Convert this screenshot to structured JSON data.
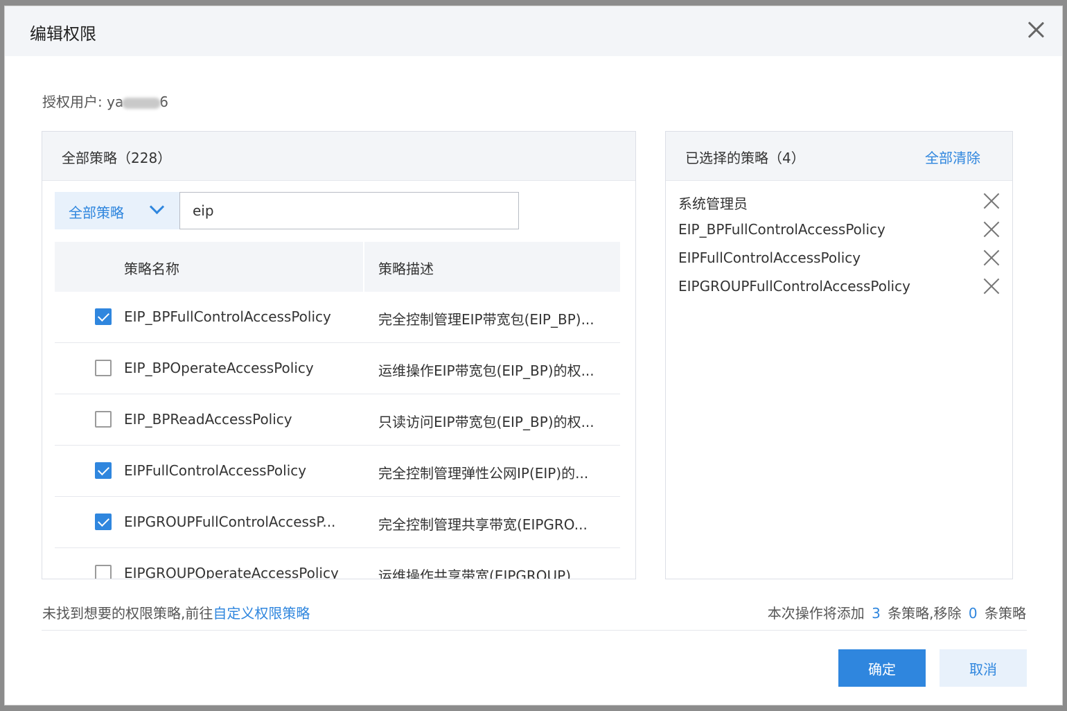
{
  "modal": {
    "title": "编辑权限",
    "auth_user_label": "授权用户: ",
    "auth_user_prefix": "ya",
    "auth_user_suffix": "6"
  },
  "left_panel": {
    "title": "全部策略（228）",
    "filter_selected": "全部策略",
    "search_value": "eip",
    "columns": {
      "name": "策略名称",
      "desc": "策略描述"
    },
    "rows": [
      {
        "name": "EIP_BPFullControlAccessPolicy",
        "desc": "完全控制管理EIP带宽包(EIP_BP)...",
        "checked": true
      },
      {
        "name": "EIP_BPOperateAccessPolicy",
        "desc": "运维操作EIP带宽包(EIP_BP)的权...",
        "checked": false
      },
      {
        "name": "EIP_BPReadAccessPolicy",
        "desc": "只读访问EIP带宽包(EIP_BP)的权...",
        "checked": false
      },
      {
        "name": "EIPFullControlAccessPolicy",
        "desc": "完全控制管理弹性公网IP(EIP)的...",
        "checked": true
      },
      {
        "name": "EIPGROUPFullControlAccessP...",
        "desc": "完全控制管理共享带宽(EIPGRO...",
        "checked": true
      },
      {
        "name": "EIPGROUPOperateAccessPolicy",
        "desc": "运维操作共享带宽(EIPGROUP)...",
        "checked": false
      }
    ]
  },
  "right_panel": {
    "title": "已选择的策略（4）",
    "clear_all": "全部清除",
    "items": [
      "系统管理员",
      "EIP_BPFullControlAccessPolicy",
      "EIPFullControlAccessPolicy",
      "EIPGROUPFullControlAccessPolicy"
    ]
  },
  "footer": {
    "hint_text": "未找到想要的权限策略,前往",
    "hint_link": "自定义权限策略",
    "summary_prefix": "本次操作将添加",
    "added_count": "3",
    "summary_middle": "条策略,移除",
    "removed_count": "0",
    "summary_suffix": "条策略"
  },
  "buttons": {
    "ok": "确定",
    "cancel": "取消"
  },
  "colors": {
    "accent": "#2f86de",
    "header_bg": "#f3f5f8",
    "select_bg": "#e8f1fb"
  }
}
